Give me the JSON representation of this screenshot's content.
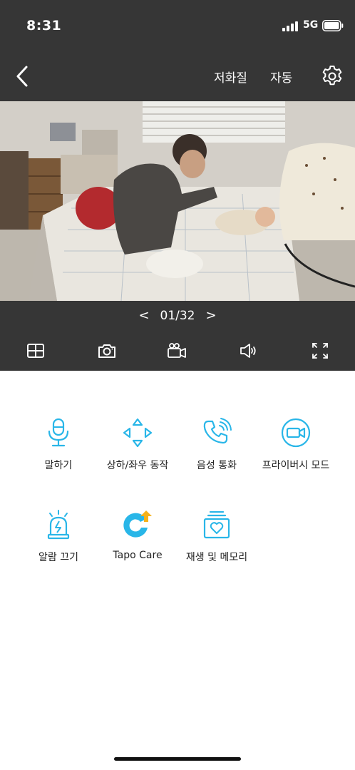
{
  "status_bar": {
    "time": "8:31",
    "network": "5G"
  },
  "nav": {
    "quality": "저화질",
    "mode": "자동"
  },
  "pager": {
    "prev": "<",
    "count": "01/32",
    "next": ">"
  },
  "colors": {
    "accent": "#29b6e8",
    "dark_bar": "#363636",
    "care_orange": "#f5b11a"
  },
  "controls": [
    "grid-view-icon",
    "snapshot-camera-icon",
    "record-video-icon",
    "speaker-volume-icon",
    "fullscreen-icon"
  ],
  "features": [
    {
      "label": "말하기",
      "icon": "microphone-icon"
    },
    {
      "label": "상하/좌우 동작",
      "icon": "pan-tilt-arrows-icon"
    },
    {
      "label": "음성 통화",
      "icon": "phone-call-icon"
    },
    {
      "label": "프라이버시 모드",
      "icon": "privacy-camera-icon"
    },
    {
      "label": "알람 끄기",
      "icon": "alarm-siren-icon"
    },
    {
      "label": "Tapo Care",
      "icon": "tapo-care-icon"
    },
    {
      "label": "재생 및 메모리",
      "icon": "playback-memory-icon"
    }
  ]
}
